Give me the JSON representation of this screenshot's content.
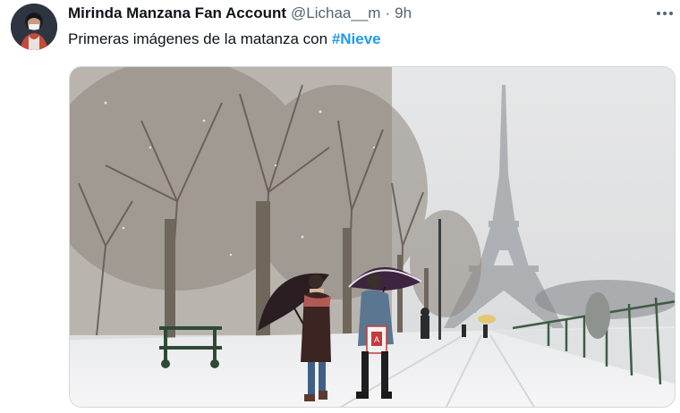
{
  "tweet": {
    "author": {
      "display_name": "Mirinda Manzana Fan Account",
      "handle": "@Lichaa__m",
      "avatar_icon": "profile-avatar"
    },
    "separator": "·",
    "time": "9h",
    "more_icon": "more-options-icon",
    "text_plain": "Primeras imágenes de la matanza con ",
    "hashtag": "#Nieve",
    "media": {
      "description_icon": "photo",
      "shopping_bag_text": "A"
    }
  },
  "colors": {
    "text": "#0f1419",
    "secondary": "#536471",
    "hashtag": "#1d9bf0",
    "border": "#cfd9de"
  }
}
